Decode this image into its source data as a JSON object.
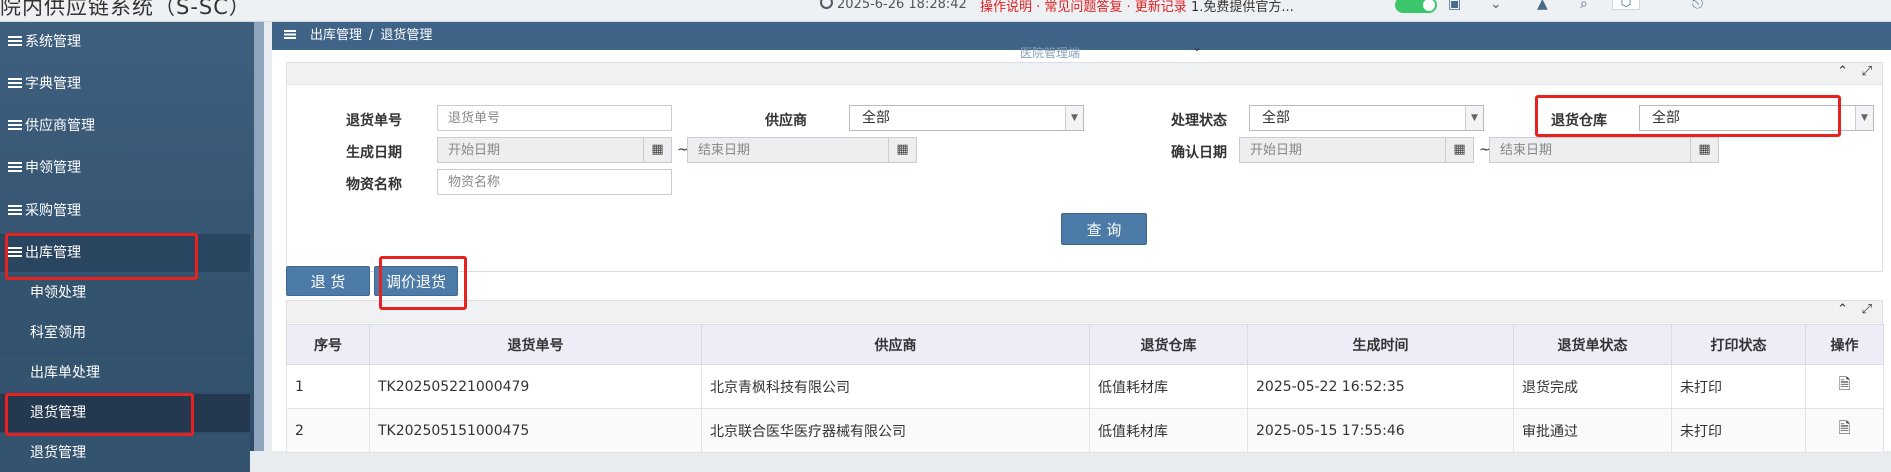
{
  "app": {
    "title": "院内供应链系统（S-SC）",
    "clock": "2025-6-26 18:28:42",
    "notice": "操作说明 · 常见问题答复 · 更新记录",
    "notice_tail": "1.免费提供官方..."
  },
  "sidebar": {
    "items": [
      {
        "label": "系统管理"
      },
      {
        "label": "字典管理"
      },
      {
        "label": "供应商管理"
      },
      {
        "label": "申领管理"
      },
      {
        "label": "采购管理"
      },
      {
        "label": "出库管理"
      }
    ],
    "subitems": [
      {
        "label": "申领处理"
      },
      {
        "label": "科室领用"
      },
      {
        "label": "出库单处理"
      },
      {
        "label": "退货管理"
      },
      {
        "label": "退货管理"
      }
    ]
  },
  "breadcrumb": {
    "parent": "出库管理",
    "separator": "/",
    "current": "退货管理"
  },
  "fragment_text": "医院管理端",
  "filter": {
    "return_no": {
      "label": "退货单号",
      "placeholder": "退货单号"
    },
    "supplier": {
      "label": "供应商",
      "value": "全部"
    },
    "process_status": {
      "label": "处理状态",
      "value": "全部"
    },
    "return_warehouse": {
      "label": "退货仓库",
      "value": "全部"
    },
    "create_date": {
      "label": "生成日期",
      "start_placeholder": "开始日期",
      "end_placeholder": "结束日期"
    },
    "confirm_date": {
      "label": "确认日期",
      "start_placeholder": "开始日期",
      "end_placeholder": "结束日期"
    },
    "material_name": {
      "label": "物资名称",
      "placeholder": "物资名称"
    },
    "range_sep": "~",
    "query_button": "查 询"
  },
  "actions": {
    "return_button": "退 货",
    "price_adjust_return_button": "调价退货"
  },
  "table": {
    "columns": [
      "序号",
      "退货单号",
      "供应商",
      "退货仓库",
      "生成时间",
      "退货单状态",
      "打印状态",
      "操作"
    ],
    "rows": [
      {
        "index": "1",
        "return_no": "TK202505221000479",
        "supplier": "北京青枫科技有限公司",
        "warehouse": "低值耗材库",
        "created": "2025-05-22 16:52:35",
        "status": "退货完成",
        "print_status": "未打印"
      },
      {
        "index": "2",
        "return_no": "TK202505151000475",
        "supplier": "北京联合医华医疗器械有限公司",
        "warehouse": "低值耗材库",
        "created": "2025-05-15 17:55:46",
        "status": "审批通过",
        "print_status": "未打印"
      }
    ]
  },
  "colors": {
    "accent": "#4b7ba6",
    "sidebar": "#3e5f7e",
    "highlight": "#e8231f",
    "header_bar": "#3f6488"
  }
}
